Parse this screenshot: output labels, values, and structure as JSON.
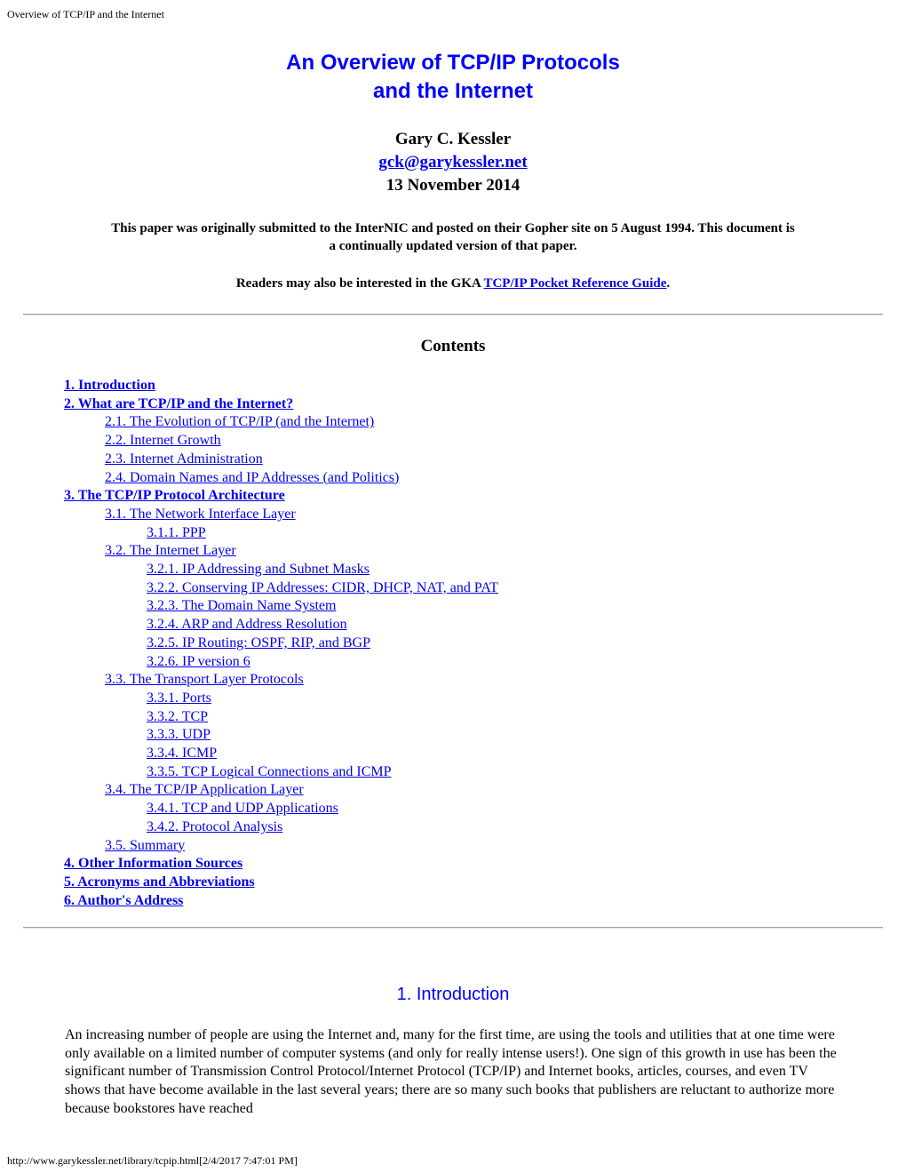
{
  "print_header": "Overview of TCP/IP and the Internet",
  "title": {
    "line1": "An Overview of TCP/IP Protocols",
    "line2": "and the Internet"
  },
  "author": {
    "name": "Gary C. Kessler",
    "email": "gck@garykessler.net",
    "date": "13 November 2014"
  },
  "notes": {
    "origin": "This paper was originally submitted to the InterNIC and posted on their Gopher site on 5 August 1994. This document is a continually updated version of that paper.",
    "readers_prefix": "Readers may also be interested in the GKA ",
    "readers_link": "TCP/IP Pocket Reference Guide",
    "readers_suffix": "."
  },
  "contents": {
    "heading": "Contents",
    "items": [
      {
        "level": 0,
        "label": "1. Introduction"
      },
      {
        "level": 0,
        "label": "2. What are TCP/IP and the Internet?"
      },
      {
        "level": 1,
        "label": "2.1. The Evolution of TCP/IP (and the Internet)"
      },
      {
        "level": 1,
        "label": "2.2. Internet Growth"
      },
      {
        "level": 1,
        "label": "2.3. Internet Administration"
      },
      {
        "level": 1,
        "label": "2.4. Domain Names and IP Addresses (and Politics)"
      },
      {
        "level": 0,
        "label": "3. The TCP/IP Protocol Architecture"
      },
      {
        "level": 1,
        "label": "3.1. The Network Interface Layer"
      },
      {
        "level": 2,
        "label": "3.1.1. PPP"
      },
      {
        "level": 1,
        "label": "3.2. The Internet Layer"
      },
      {
        "level": 2,
        "label": "3.2.1. IP Addressing and Subnet Masks"
      },
      {
        "level": 2,
        "label": "3.2.2. Conserving IP Addresses: CIDR, DHCP, NAT, and PAT"
      },
      {
        "level": 2,
        "label": "3.2.3. The Domain Name System"
      },
      {
        "level": 2,
        "label": "3.2.4. ARP and Address Resolution"
      },
      {
        "level": 2,
        "label": "3.2.5. IP Routing: OSPF, RIP, and BGP"
      },
      {
        "level": 2,
        "label": "3.2.6. IP version 6"
      },
      {
        "level": 1,
        "label": "3.3. The Transport Layer Protocols"
      },
      {
        "level": 2,
        "label": "3.3.1. Ports"
      },
      {
        "level": 2,
        "label": "3.3.2. TCP"
      },
      {
        "level": 2,
        "label": "3.3.3. UDP"
      },
      {
        "level": 2,
        "label": "3.3.4. ICMP"
      },
      {
        "level": 2,
        "label": "3.3.5. TCP Logical Connections and ICMP"
      },
      {
        "level": 1,
        "label": "3.4. The TCP/IP Application Layer"
      },
      {
        "level": 2,
        "label": "3.4.1. TCP and UDP Applications"
      },
      {
        "level": 2,
        "label": "3.4.2. Protocol Analysis"
      },
      {
        "level": 1,
        "label": "3.5. Summary"
      },
      {
        "level": 0,
        "label": "4. Other Information Sources"
      },
      {
        "level": 0,
        "label": "5. Acronyms and Abbreviations"
      },
      {
        "level": 0,
        "label": "6. Author's Address"
      }
    ]
  },
  "introduction": {
    "heading": "1. Introduction",
    "paragraph": "An increasing number of people are using the Internet and, many for the first time, are using the tools and utilities that at one time were only available on a limited number of computer systems (and only for really intense users!). One sign of this growth in use has been the significant number of Transmission Control Protocol/Internet Protocol (TCP/IP) and Internet books, articles, courses, and even TV shows that have become available in the last several years; there are so many such books that publishers are reluctant to authorize more because bookstores have reached"
  },
  "print_footer": "http://www.garykessler.net/library/tcpip.html[2/4/2017 7:47:01 PM]",
  "colors": {
    "title_blue": "#0000ff",
    "link_blue": "#0000ee",
    "rule_gray": "#a0a0a0"
  }
}
